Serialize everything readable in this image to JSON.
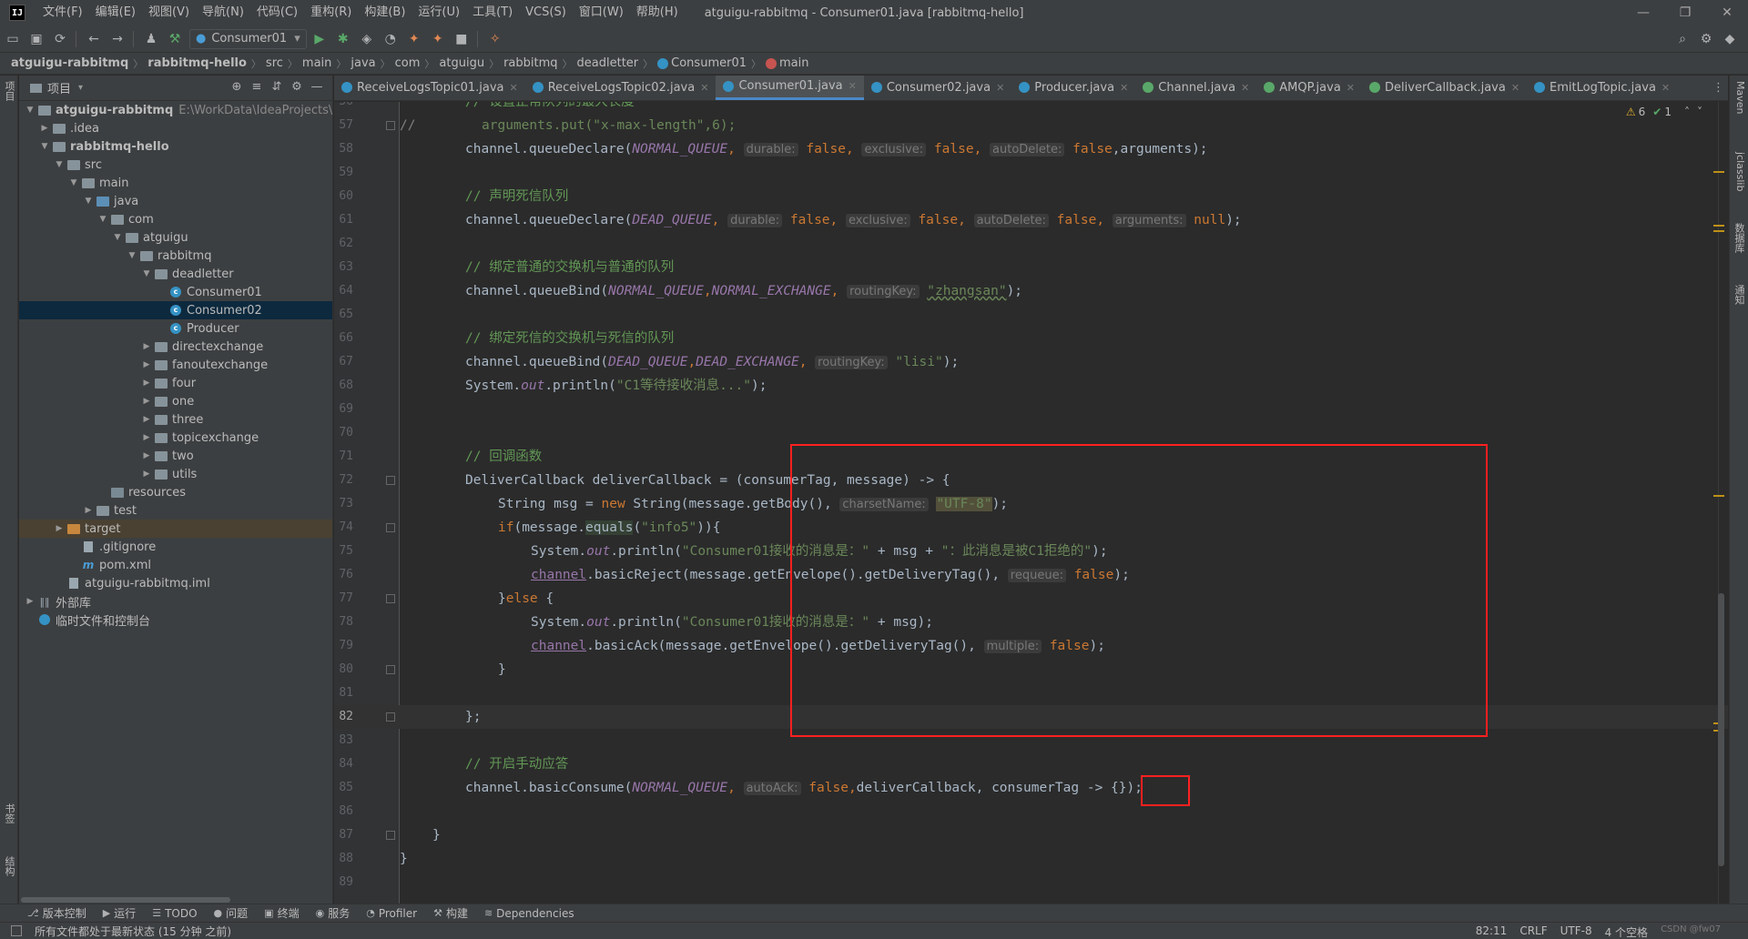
{
  "app": {
    "logo": "IJ",
    "menu": [
      "文件(F)",
      "编辑(E)",
      "视图(V)",
      "导航(N)",
      "代码(C)",
      "重构(R)",
      "构建(B)",
      "运行(U)",
      "工具(T)",
      "VCS(S)",
      "窗口(W)",
      "帮助(H)"
    ],
    "window_title": "atguigu-rabbitmq - Consumer01.java [rabbitmq-hello]",
    "run_config": "Consumer01"
  },
  "breadcrumbs": [
    "atguigu-rabbitmq",
    "rabbitmq-hello",
    "src",
    "main",
    "java",
    "com",
    "atguigu",
    "rabbitmq",
    "deadletter",
    "Consumer01",
    "main"
  ],
  "left_strip": {
    "project": "项目",
    "bookmarks": "书签",
    "structure": "结构"
  },
  "project_panel": {
    "title": "项目",
    "tree": [
      {
        "label": "atguigu-rabbitmq",
        "path": "E:\\WorkData\\IdeaProjects\\Ra",
        "bold": true
      },
      {
        "label": ".idea"
      },
      {
        "label": "rabbitmq-hello",
        "bold": true
      },
      {
        "label": "src"
      },
      {
        "label": "main"
      },
      {
        "label": "java"
      },
      {
        "label": "com"
      },
      {
        "label": "atguigu"
      },
      {
        "label": "rabbitmq"
      },
      {
        "label": "deadletter"
      },
      {
        "label": "Consumer01"
      },
      {
        "label": "Consumer02"
      },
      {
        "label": "Producer"
      },
      {
        "label": "directexchange"
      },
      {
        "label": "fanoutexchange"
      },
      {
        "label": "four"
      },
      {
        "label": "one"
      },
      {
        "label": "three"
      },
      {
        "label": "topicexchange"
      },
      {
        "label": "two"
      },
      {
        "label": "utils"
      },
      {
        "label": "resources"
      },
      {
        "label": "test"
      },
      {
        "label": "target"
      },
      {
        "label": ".gitignore"
      },
      {
        "label": "pom.xml"
      },
      {
        "label": "atguigu-rabbitmq.iml"
      },
      {
        "label": "外部库"
      },
      {
        "label": "临时文件和控制台"
      }
    ]
  },
  "editor_tabs": [
    "ReceiveLogsTopic01.java",
    "ReceiveLogsTopic02.java",
    "Consumer01.java",
    "Consumer02.java",
    "Producer.java",
    "Channel.java",
    "AMQP.java",
    "DeliverCallback.java",
    "EmitLogTopic.java"
  ],
  "inspections": {
    "warnings": "6",
    "ok": "1"
  },
  "code": {
    "line_numbers": [
      "56",
      "57",
      "58",
      "59",
      "60",
      "61",
      "62",
      "63",
      "64",
      "65",
      "66",
      "67",
      "68",
      "69",
      "70",
      "71",
      "72",
      "73",
      "74",
      "75",
      "76",
      "77",
      "78",
      "79",
      "80",
      "81",
      "82",
      "83",
      "84",
      "85",
      "86",
      "87",
      "88",
      "89"
    ],
    "l56": "// 设置正常队列的最大长度",
    "l57_slash": "//",
    "l57": "arguments.put(\"x-max-length\",6);",
    "l58_a": "channel.queueDeclare(",
    "l58_const": "NORMAL_QUEUE",
    "l58_h1": "durable:",
    "l58_h2": "exclusive:",
    "l58_h3": "autoDelete:",
    "l58_end": ",arguments);",
    "kw_false": "false",
    "l60": "// 声明死信队列",
    "l61_a": "channel.queueDeclare(",
    "l61_const": "DEAD_QUEUE",
    "l61_h4": "arguments:",
    "l61_null": "null",
    "l63": "// 绑定普通的交换机与普通的队列",
    "l64_a": "channel.queueBind(",
    "l64_c1": "NORMAL_QUEUE",
    "l64_c2": "NORMAL_EXCHANGE",
    "l64_h": "routingKey:",
    "l64_s": "\"zhangsan\"",
    "l66": "// 绑定死信的交换机与死信的队列",
    "l67_a": "channel.queueBind(",
    "l67_c1": "DEAD_QUEUE",
    "l67_c2": "DEAD_EXCHANGE",
    "l67_h": "routingKey:",
    "l67_s": "\"lisi\"",
    "l68_a": "System.",
    "l68_out": "out",
    "l68_b": ".println(",
    "l68_s": "\"C1等待接收消息...\"",
    "l71": "// 回调函数",
    "l72": "DeliverCallback deliverCallback = (consumerTag, message) -> {",
    "l73_a": "String msg = ",
    "l73_new": "new",
    "l73_b": " String(message.getBody(), ",
    "l73_h": "charsetName:",
    "l73_s": "\"UTF-8\"",
    "l74_if": "if",
    "l74_a": "(message.",
    "l74_eq": "equals",
    "l74_b": "(",
    "l74_s": "\"info5\"",
    "l74_c": ")){",
    "l75_s1": "\"Consumer01接收的消息是：\"",
    "l75_mid": " + msg + ",
    "l75_s2": "\"：此消息是被C1拒绝的\"",
    "l76_ch": "channel",
    "l76_a": ".basicReject(message.getEnvelope().getDeliveryTag(),",
    "l76_h": "requeue:",
    "l77_else": "else",
    "l78_s": "\"Consumer01接收的消息是：\"",
    "l78_end": " + msg);",
    "l79_ch": "channel",
    "l79_a": ".basicAck(message.getEnvelope().getDeliveryTag(),",
    "l79_h": "multiple:",
    "l82": "};",
    "l84": "// 开启手动应答",
    "l85_a": "channel.basicConsume(",
    "l85_c": "NORMAL_QUEUE",
    "l85_h": "autoAck:",
    "l85_end": "deliverCallback, consumerTag -> {});"
  },
  "right_strip": {
    "maven": "Maven",
    "jclasslib": "jclasslib",
    "database": "数据库",
    "notifications": "通知"
  },
  "bottom_tabs": [
    "版本控制",
    "运行",
    "TODO",
    "问题",
    "终端",
    "服务",
    "Profiler",
    "构建",
    "Dependencies"
  ],
  "status": {
    "message": "所有文件都处于最新状态 (15 分钟 之前)",
    "position": "82:11",
    "line_sep": "CRLF",
    "encoding": "UTF-8",
    "indent": "4 个空格",
    "watermark": "CSDN @fw07"
  },
  "colors": {
    "highlight_box": "#ff2020",
    "active_tab_underline": "#4a88c7",
    "selection": "#0d293e"
  }
}
